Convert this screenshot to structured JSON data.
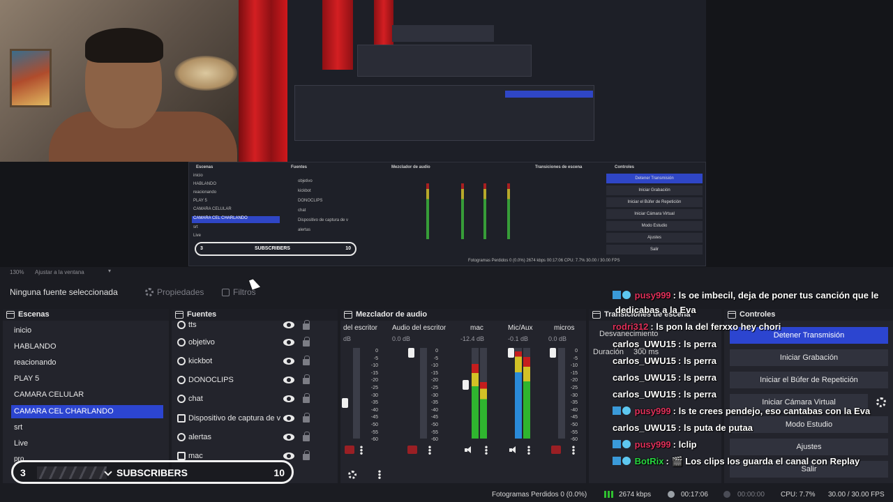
{
  "preview": {
    "nested": {
      "scenes_title": "Escenas",
      "sources_title": "Fuentes",
      "mixer_title": "Mezclador de audio",
      "transitions_title": "Transiciones de escena",
      "controls_title": "Controles",
      "scenes": [
        "inicio",
        "HABLANDO",
        "reacionando",
        "PLAY 5",
        "CAMARA CELULAR",
        "CAMARA CEL CHARLANDO",
        "srt",
        "Live"
      ],
      "sources": [
        "objetivo",
        "kickbot",
        "DONOCLIPS",
        "chat",
        "Dispositivo de captura de v",
        "alertas"
      ],
      "buttons": [
        "Detener Transmisión",
        "Iniciar Grabación",
        "Iniciar el Búfer de Repetición",
        "Iniciar Cámara Virtual",
        "Modo Estudio",
        "Ajustes",
        "Salir"
      ],
      "subs_label": "SUBSCRIBERS",
      "subs_count": "3",
      "subs_goal": "10",
      "status": "Fotogramas Perdidos 0 (0.0%)   2674 kbps   00:17:06   CPU: 7.7%   30.00 / 30.00 FPS"
    }
  },
  "zoom": {
    "level": "130%",
    "fit_label": "Ajustar a la ventana"
  },
  "propbar": {
    "no_source": "Ninguna fuente seleccionada",
    "properties": "Propiedades",
    "filters": "Filtros"
  },
  "scenes": {
    "title": "Escenas",
    "items": [
      "inicio",
      "HABLANDO",
      "reacionando",
      "PLAY 5",
      "CAMARA CELULAR",
      "CAMARA CEL CHARLANDO",
      "srt",
      "Live",
      "pro"
    ],
    "selected": "CAMARA CEL CHARLANDO"
  },
  "sources": {
    "title": "Fuentes",
    "items": [
      "tts",
      "objetivo",
      "kickbot",
      "DONOCLIPS",
      "chat",
      "Dispositivo de captura de v",
      "alertas",
      "mac"
    ]
  },
  "mixer": {
    "title": "Mezclador de audio",
    "channels": [
      {
        "name": "del escritor",
        "db": "dB"
      },
      {
        "name": "Audio del escritor",
        "db": "0.0 dB"
      },
      {
        "name": "mac",
        "db": "-12.4 dB"
      },
      {
        "name": "Mic/Aux",
        "db": "-0.1 dB"
      },
      {
        "name": "micros",
        "db": "0.0 dB"
      }
    ],
    "scale": [
      "0",
      "-5",
      "-10",
      "-15",
      "-20",
      "-25",
      "-30",
      "-35",
      "-40",
      "-45",
      "-50",
      "-55",
      "-60"
    ]
  },
  "transitions": {
    "title": "Transiciones de escena",
    "type": "Desvanecimiento",
    "duration_label": "Duración",
    "duration_value": "300 ms"
  },
  "controls": {
    "title": "Controles",
    "buttons": [
      "Detener Transmisión",
      "Iniciar Grabación",
      "Iniciar el Búfer de Repetición",
      "Iniciar Cámara Virtual",
      "Modo Estudio",
      "Ajustes",
      "Salir"
    ]
  },
  "chat": [
    {
      "user": "pusy999",
      "text": ": ls oe imbecil, deja de poner tus canción que le",
      "style": "pink",
      "badges": true
    },
    {
      "user": "",
      "text": "dedicabas a la Eva",
      "style": "cont",
      "badges": false
    },
    {
      "user": "rodri312",
      "text": ": ls pon la del ferxxo hey chori",
      "style": "pink",
      "badges": false
    },
    {
      "user": "carlos_UWU15",
      "text": ": ls perra",
      "style": "plain",
      "badges": false
    },
    {
      "user": "carlos_UWU15",
      "text": ": ls perra",
      "style": "plain",
      "badges": false
    },
    {
      "user": "carlos_UWU15",
      "text": ": ls perra",
      "style": "plain",
      "badges": false
    },
    {
      "user": "carlos_UWU15",
      "text": ": ls perra",
      "style": "plain",
      "badges": false
    },
    {
      "user": "pusy999",
      "text": ": ls te crees pendejo, eso cantabas con la Eva",
      "style": "pink",
      "badges": true
    },
    {
      "user": "carlos_UWU15",
      "text": ": ls puta de putaa",
      "style": "plain",
      "badges": false
    },
    {
      "user": "pusy999",
      "text": ": lclip",
      "style": "pink",
      "badges": true
    },
    {
      "user": "BotRix",
      "text": ": 🎬 Los clips los guarda el canal con Replay",
      "style": "grn",
      "badges": true
    }
  ],
  "subscribers": {
    "count": "3",
    "label": "SUBSCRIBERS",
    "goal": "10"
  },
  "status": {
    "dropped": "Fotogramas Perdidos 0 (0.0%)",
    "bitrate": "2674 kbps",
    "stream_time": "00:17:06",
    "rec_time": "00:00:00",
    "cpu": "CPU: 7.7%",
    "fps": "30.00 / 30.00 FPS"
  },
  "colors": {
    "accent": "#2c45d0",
    "panel": "#23242c",
    "background": "#1b1c22",
    "chat_pink": "#e0305a",
    "chat_green": "#27d63f"
  }
}
